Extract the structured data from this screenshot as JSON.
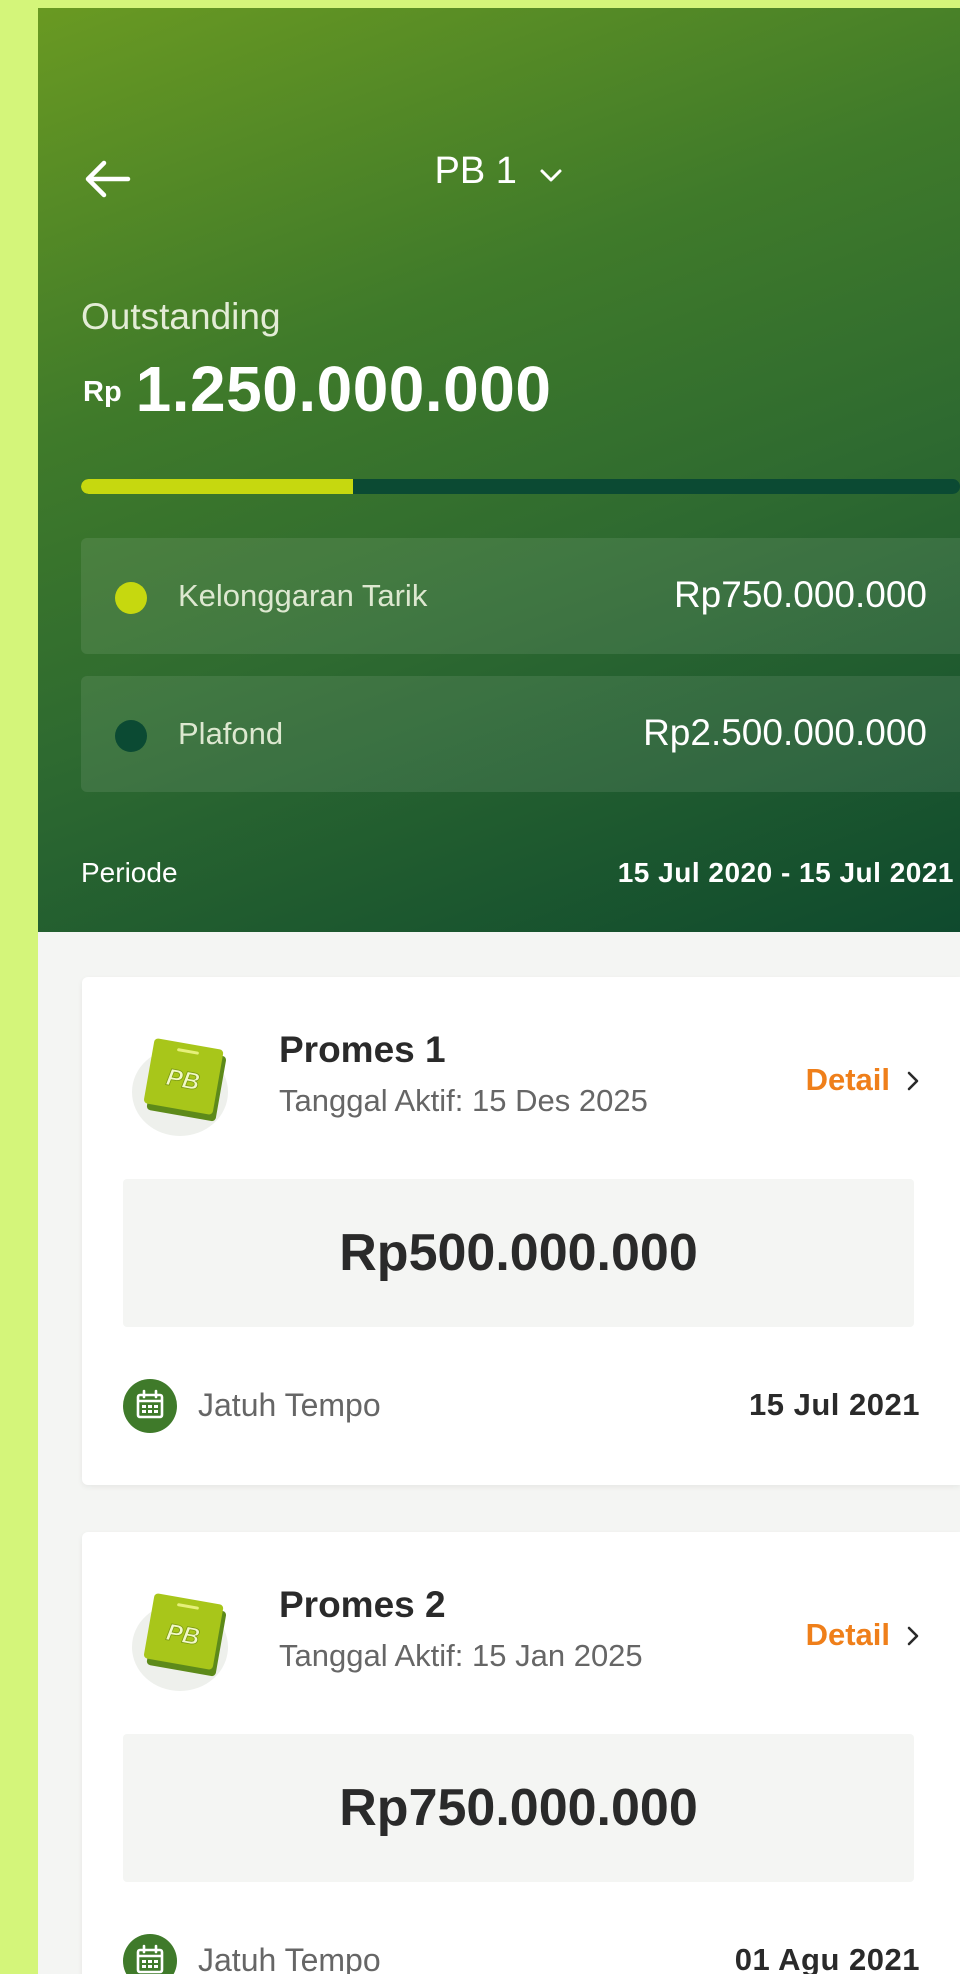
{
  "header": {
    "title": "PB 1",
    "outstanding_label": "Outstanding",
    "currency": "Rp",
    "outstanding_amount": "1.250.000.000",
    "progress_fraction": 0.31,
    "rows": [
      {
        "label": "Kelonggaran Tarik",
        "value": "Rp750.000.000",
        "dot_color": "#c6d80f"
      },
      {
        "label": "Plafond",
        "value": "Rp2.500.000.000",
        "dot_color": "#0b4a33"
      }
    ],
    "periode_label": "Periode",
    "periode_value": "15 Jul 2020 - 15 Jul 2021"
  },
  "promes": [
    {
      "name": "Promes 1",
      "tanggal_aktif": "Tanggal Aktif: 15 Des 2025",
      "detail_label": "Detail",
      "amount": "Rp500.000.000",
      "jatuh_tempo_label": "Jatuh Tempo",
      "jatuh_tempo_value": "15 Jul 2021"
    },
    {
      "name": "Promes 2",
      "tanggal_aktif": "Tanggal Aktif: 15 Jan 2025",
      "detail_label": "Detail",
      "amount": "Rp750.000.000",
      "jatuh_tempo_label": "Jatuh Tempo",
      "jatuh_tempo_value": "01 Agu 2021"
    }
  ],
  "logo_text": "PB",
  "colors": {
    "accent": "#ef7f1a",
    "brand_green": "#3f7a2a",
    "lime": "#c6d80f"
  }
}
